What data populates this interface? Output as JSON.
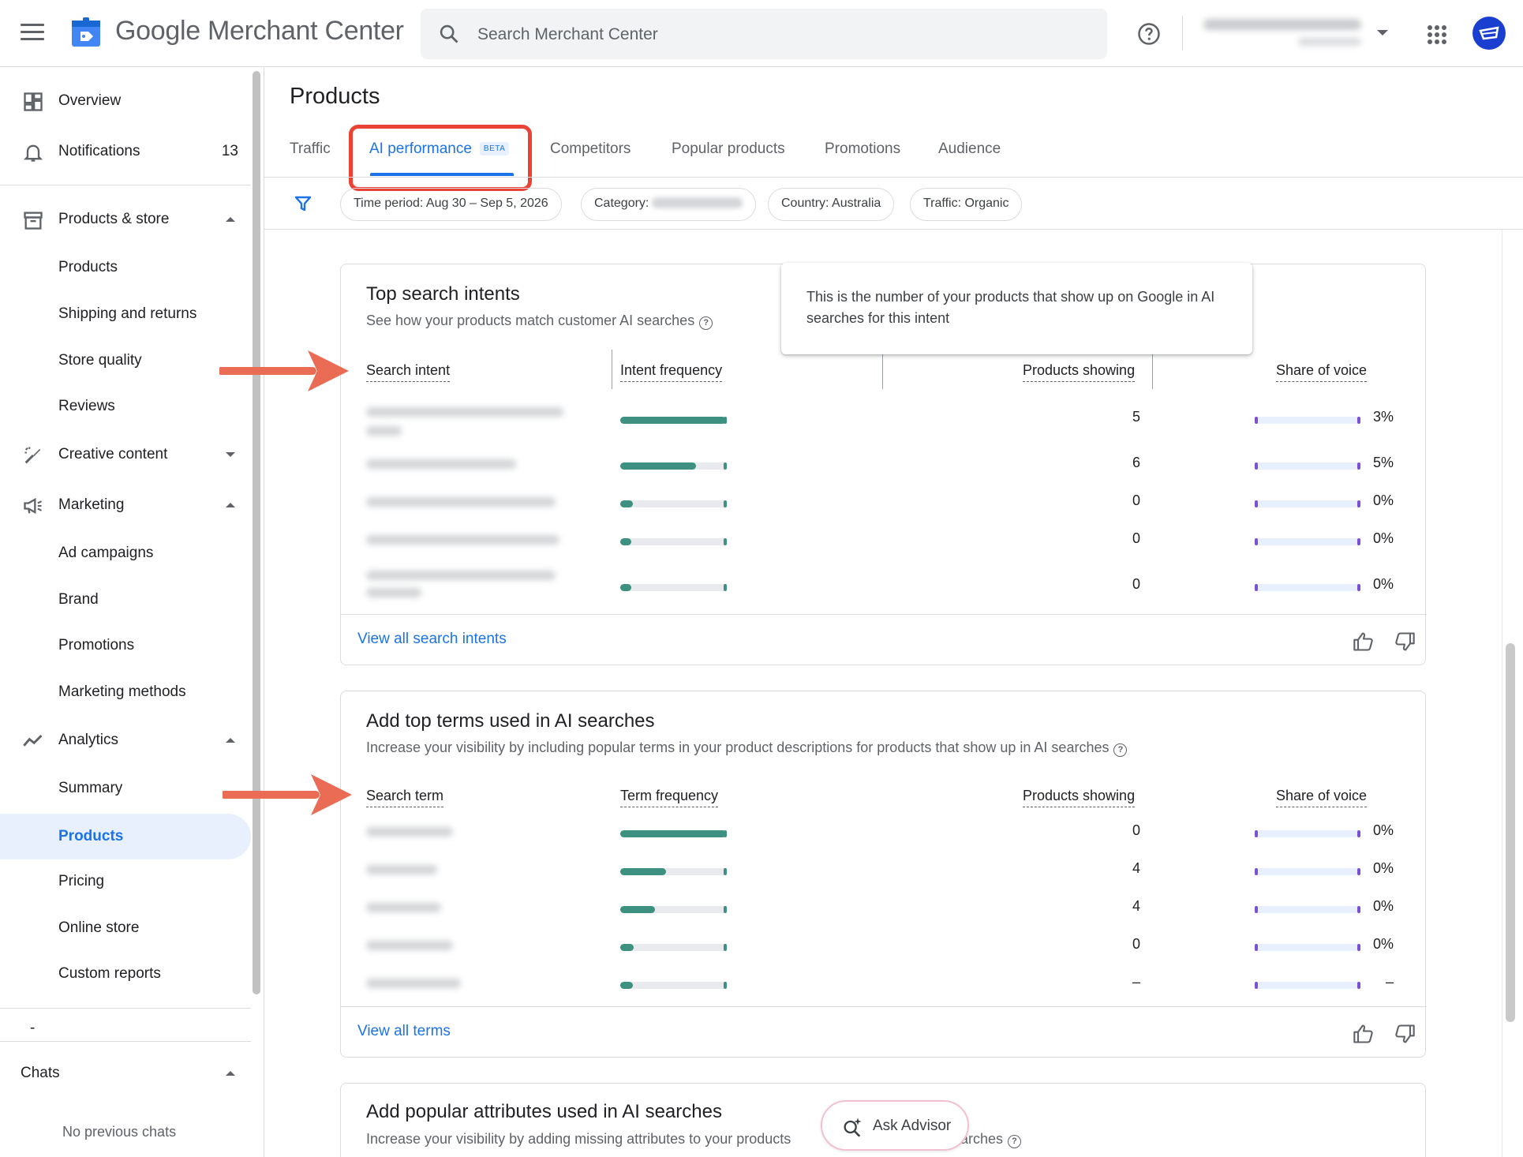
{
  "header": {
    "brand": "Google Merchant Center",
    "search_placeholder": "Search Merchant Center"
  },
  "sidebar": {
    "overview": "Overview",
    "notifications": "Notifications",
    "notifications_count": "13",
    "products_store": "Products & store",
    "products": "Products",
    "shipping": "Shipping and returns",
    "store_quality": "Store quality",
    "reviews": "Reviews",
    "creative": "Creative content",
    "marketing": "Marketing",
    "ad_campaigns": "Ad campaigns",
    "brand": "Brand",
    "promotions": "Promotions",
    "marketing_methods": "Marketing methods",
    "analytics": "Analytics",
    "summary": "Summary",
    "analytics_products": "Products",
    "pricing": "Pricing",
    "online_store": "Online store",
    "custom_reports": "Custom reports",
    "dash": "-",
    "chats": "Chats",
    "no_chats": "No previous chats"
  },
  "page": {
    "title": "Products",
    "tabs": {
      "traffic": "Traffic",
      "ai": "AI performance",
      "beta": "BETA",
      "competitors": "Competitors",
      "popular": "Popular products",
      "promotions": "Promotions",
      "audience": "Audience"
    },
    "filters": {
      "time": "Time period: Aug 30 – Sep 5, 2026",
      "category": "Category:",
      "country": "Country: Australia",
      "traffic": "Traffic: Organic"
    }
  },
  "intents": {
    "title": "Top search intents",
    "subtitle": "See how your products match customer AI searches",
    "col_intent": "Search intent",
    "col_freq": "Intent frequency",
    "col_products": "Products showing",
    "col_sov": "Share of voice",
    "rows": [
      {
        "frequency": 1.0,
        "products": "5",
        "sov": "3%"
      },
      {
        "frequency": 0.72,
        "products": "6",
        "sov": "5%"
      },
      {
        "frequency": 0.12,
        "products": "0",
        "sov": "0%"
      },
      {
        "frequency": 0.09,
        "products": "0",
        "sov": "0%"
      },
      {
        "frequency": 0.06,
        "products": "0",
        "sov": "0%"
      }
    ],
    "link": "View all search intents"
  },
  "tooltip": "This is the number of your products that show up on Google in AI searches for this intent",
  "terms": {
    "title": "Add top terms used in AI searches",
    "subtitle": "Increase your visibility by including popular terms in your product descriptions for products that show up in AI searches",
    "col_term": "Search term",
    "col_freq": "Term frequency",
    "col_products": "Products showing",
    "col_sov": "Share of voice",
    "rows": [
      {
        "frequency": 1.0,
        "products": "0",
        "sov": "0%"
      },
      {
        "frequency": 0.43,
        "products": "4",
        "sov": "0%"
      },
      {
        "frequency": 0.33,
        "products": "4",
        "sov": "0%"
      },
      {
        "frequency": 0.13,
        "products": "0",
        "sov": "0%"
      },
      {
        "frequency": 0.12,
        "products": "–",
        "sov": "–"
      }
    ],
    "link": "View all terms"
  },
  "attributes": {
    "title": "Add popular attributes used in AI searches",
    "subtitle_a": "Increase your visibility by adding missing attributes to your products",
    "subtitle_b": "arches"
  },
  "advisor": "Ask Advisor",
  "colors": {
    "accent": "#1a73e8",
    "bar": "#3e9180",
    "sov": "#7b50d1",
    "highlight": "#ea4335"
  }
}
